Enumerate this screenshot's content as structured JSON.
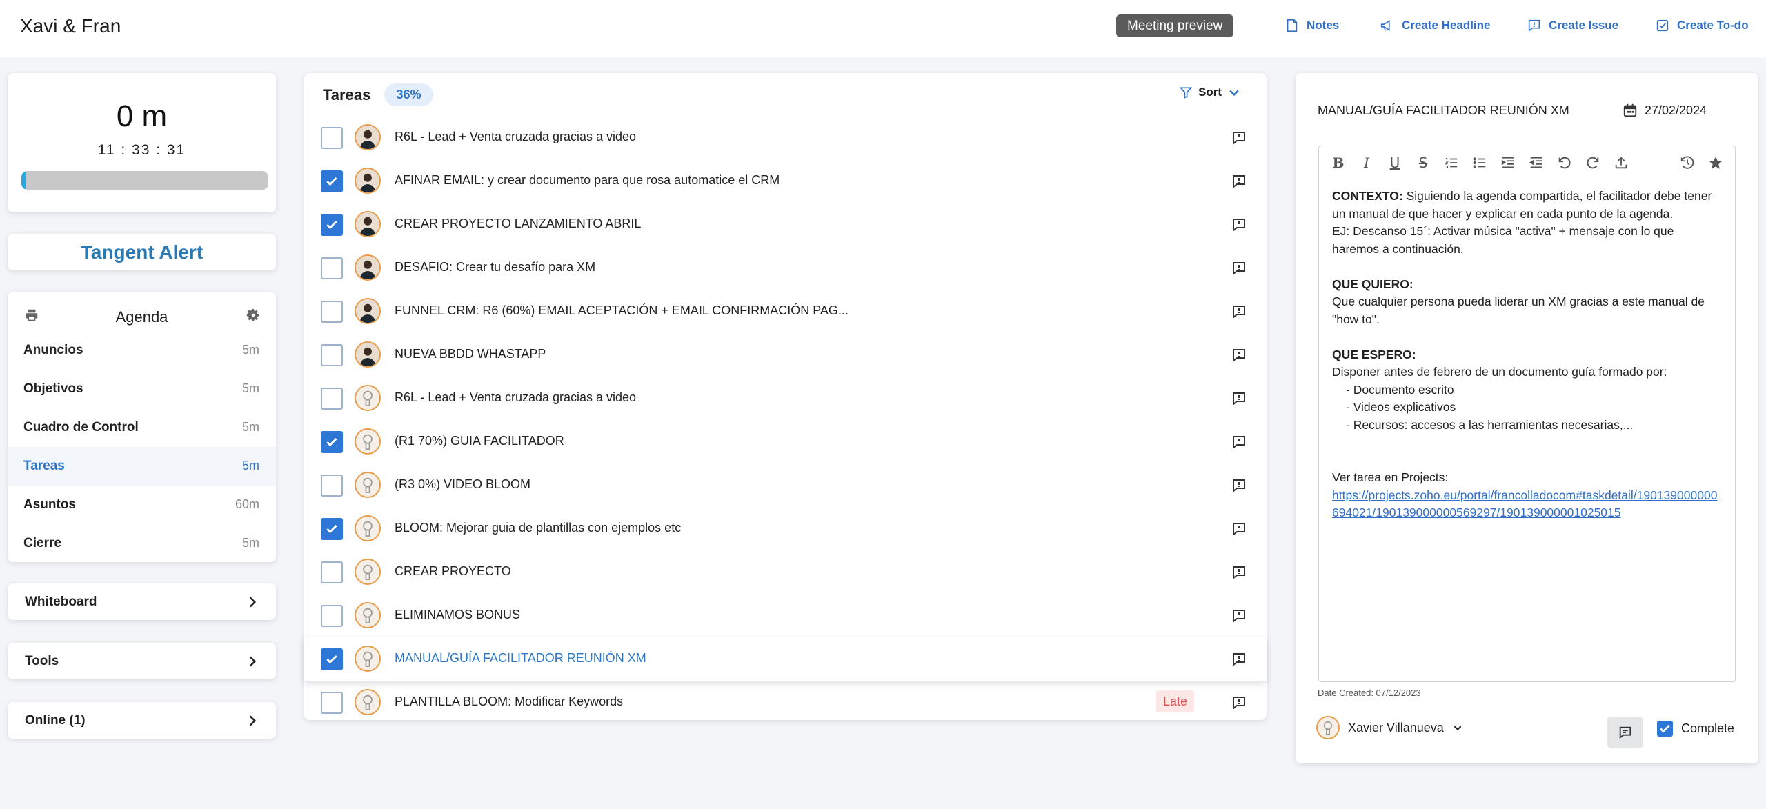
{
  "header": {
    "brand": "Xavi & Fran",
    "meeting_preview": "Meeting preview",
    "nav": [
      {
        "label": "Notes",
        "icon": "notes-icon"
      },
      {
        "label": "Create Headline",
        "icon": "megaphone-icon"
      },
      {
        "label": "Create Issue",
        "icon": "issue-icon"
      },
      {
        "label": "Create To-do",
        "icon": "todo-icon"
      }
    ]
  },
  "timer": {
    "minutes": "0 m",
    "clock": "11 : 33 : 31",
    "progress": 0.02,
    "bar_color": "#2da7e0"
  },
  "tangent_alert": "Tangent Alert",
  "agenda": {
    "title": "Agenda",
    "items": [
      {
        "label": "Anuncios",
        "time": "5m"
      },
      {
        "label": "Objetivos",
        "time": "5m"
      },
      {
        "label": "Cuadro de Control",
        "time": "5m"
      },
      {
        "label": "Tareas",
        "time": "5m",
        "active": true
      },
      {
        "label": "Asuntos",
        "time": "60m"
      },
      {
        "label": "Cierre",
        "time": "5m"
      }
    ]
  },
  "sections": {
    "whiteboard": "Whiteboard",
    "tools": "Tools",
    "online": "Online (1)"
  },
  "tasks": {
    "title": "Tareas",
    "percent": "36%",
    "sort_label": "Sort",
    "items": [
      {
        "label": "R6L - Lead + Venta cruzada gracias a video",
        "done": false,
        "avatar": "photo"
      },
      {
        "label": "AFINAR EMAIL: y crear documento para que rosa automatice el CRM",
        "done": true,
        "avatar": "photo"
      },
      {
        "label": "CREAR PROYECTO LANZAMIENTO ABRIL",
        "done": true,
        "avatar": "photo"
      },
      {
        "label": "DESAFIO: Crear tu desafío para XM",
        "done": false,
        "avatar": "photo"
      },
      {
        "label": "FUNNEL CRM: R6 (60%) EMAIL ACEPTACIÓN + EMAIL CONFIRMACIÓN PAG...",
        "done": false,
        "avatar": "photo"
      },
      {
        "label": "NUEVA BBDD WHASTAPP",
        "done": false,
        "avatar": "photo"
      },
      {
        "label": "R6L - Lead + Venta cruzada gracias a video",
        "done": false,
        "avatar": "default"
      },
      {
        "label": "(R1 70%) GUIA FACILITADOR",
        "done": true,
        "avatar": "default"
      },
      {
        "label": "(R3 0%) VIDEO BLOOM",
        "done": false,
        "avatar": "default"
      },
      {
        "label": "BLOOM: Mejorar guia de plantillas con ejemplos etc",
        "done": true,
        "avatar": "default"
      },
      {
        "label": "CREAR PROYECTO",
        "done": false,
        "avatar": "default"
      },
      {
        "label": "ELIMINAMOS BONUS",
        "done": false,
        "avatar": "default"
      },
      {
        "label": "MANUAL/GUÍA FACILITADOR REUNIÓN XM",
        "done": true,
        "avatar": "default",
        "selected": true
      },
      {
        "label": "PLANTILLA BLOOM: Modificar Keywords",
        "done": false,
        "avatar": "default",
        "badge": "Late"
      }
    ]
  },
  "detail": {
    "title": "MANUAL/GUÍA FACILITADOR REUNIÓN XM",
    "date": "27/02/2024",
    "body": {
      "contexto_label": "CONTEXTO:",
      "contexto_text": " Siguiendo la agenda compartida, el facilitador debe tener un manual de que hacer y explicar en cada punto de la agenda.",
      "ej_text": "EJ: Descanso 15´: Activar música \"activa\" + mensaje con lo que haremos a continuación.",
      "quiero_label": "QUE QUIERO:",
      "quiero_text": "Que cualquier persona pueda liderar un XM gracias a este manual de \"how to\".",
      "espero_label": "QUE ESPERO:",
      "espero_text": "Disponer antes de febrero de un documento guía formado por:",
      "bullets": [
        "- Documento escrito",
        "- Videos explicativos",
        "- Recursos: accesos a las herramientas necesarias,..."
      ],
      "link_intro": "Ver tarea en Projects:",
      "link": "https://projects.zoho.eu/portal/francolladocom#taskdetail/190139000000694021/190139000000569297/190139000001025015"
    },
    "date_created": "Date Created: 07/12/2023",
    "assignee": "Xavier Villanueva",
    "complete_label": "Complete"
  }
}
